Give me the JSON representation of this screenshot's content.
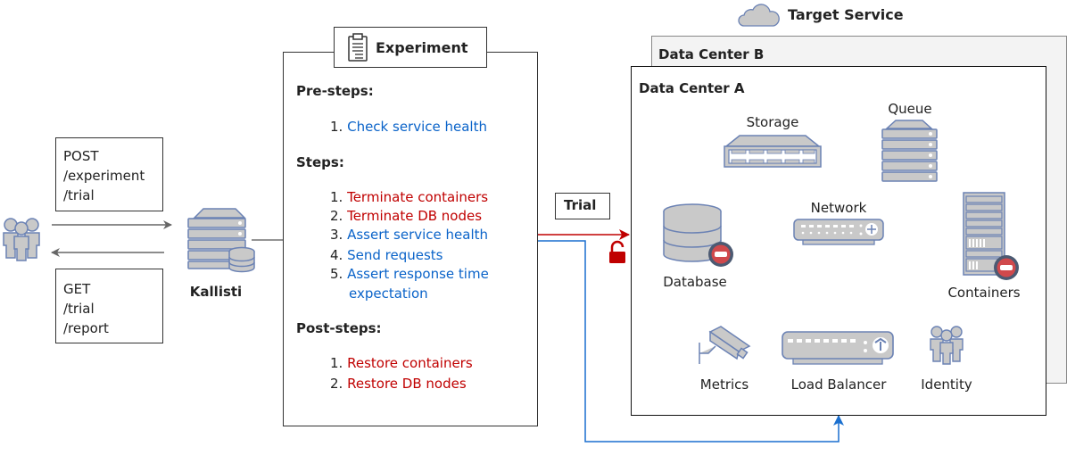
{
  "requests": {
    "post": {
      "method": "POST",
      "paths": [
        "/experiment",
        "/trial"
      ]
    },
    "get": {
      "method": "GET",
      "paths": [
        "/trial",
        "/report"
      ]
    }
  },
  "kallisti": {
    "label": "Kallisti"
  },
  "experiment": {
    "title": "Experiment",
    "sections": [
      {
        "heading": "Pre-steps:",
        "items": [
          {
            "num": "1.",
            "text": "Check service health",
            "color": "#0a63c9"
          }
        ]
      },
      {
        "heading": "Steps:",
        "items": [
          {
            "num": "1.",
            "text": "Terminate containers",
            "color": "#c00000"
          },
          {
            "num": "2.",
            "text": "Terminate DB nodes",
            "color": "#c00000"
          },
          {
            "num": "3.",
            "text": "Assert service health",
            "color": "#0a63c9"
          },
          {
            "num": "4.",
            "text": "Send requests",
            "color": "#0a63c9"
          },
          {
            "num": "5.",
            "text": "Assert response time",
            "color": "#0a63c9"
          },
          {
            "num": "",
            "text": "expectation",
            "color": "#0a63c9"
          }
        ]
      },
      {
        "heading": "Post-steps:",
        "items": [
          {
            "num": "1.",
            "text": "Restore containers",
            "color": "#c00000"
          },
          {
            "num": "2.",
            "text": "Restore DB nodes",
            "color": "#c00000"
          }
        ]
      }
    ]
  },
  "trial": {
    "label": "Trial"
  },
  "target": {
    "title": "Target Service",
    "dc_b": "Data Center B",
    "dc_a": "Data Center A",
    "components": {
      "storage": "Storage",
      "queue": "Queue",
      "network": "Network",
      "database": "Database",
      "containers": "Containers",
      "metrics": "Metrics",
      "load_balancer": "Load Balancer",
      "identity": "Identity"
    }
  },
  "colors": {
    "red_flow": "#c00000",
    "blue_flow": "#1a6fcf",
    "icon_fill": "#c9c9c9",
    "icon_stroke": "#6b82b4",
    "stop_badge": "#d0494c"
  }
}
